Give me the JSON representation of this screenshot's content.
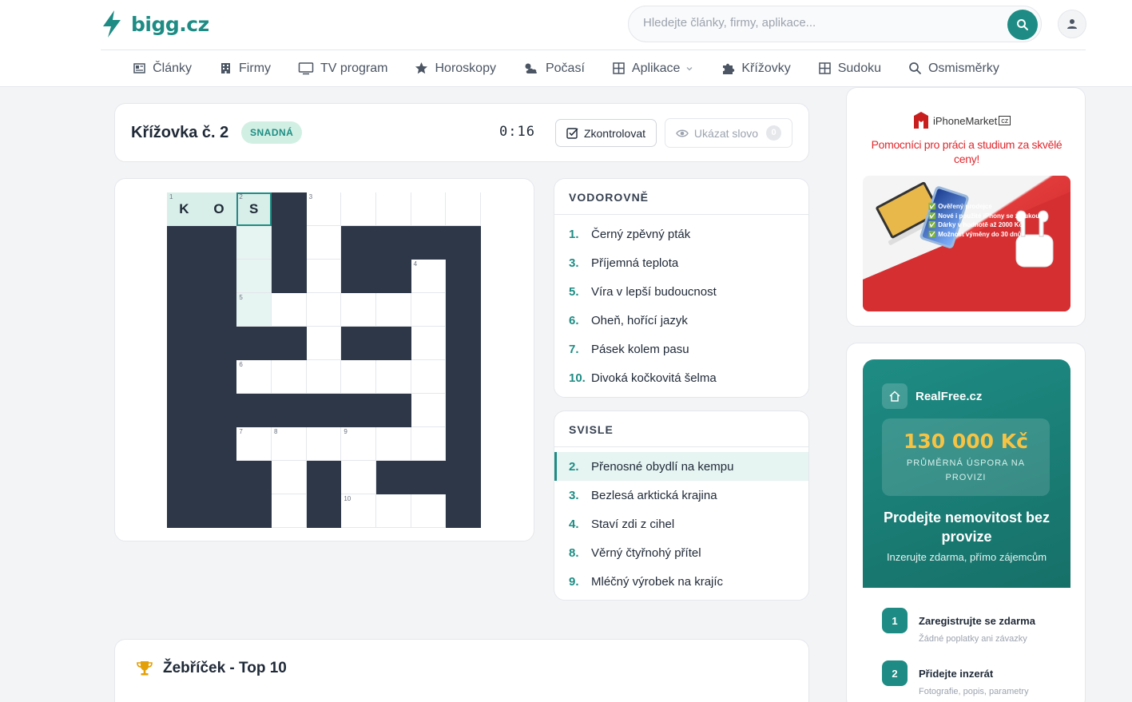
{
  "header": {
    "logo_text": "bigg.cz",
    "search_placeholder": "Hledejte články, firmy, aplikace..."
  },
  "nav": [
    {
      "label": "Články",
      "icon": "newspaper-icon"
    },
    {
      "label": "Firmy",
      "icon": "building-icon"
    },
    {
      "label": "TV program",
      "icon": "tv-icon"
    },
    {
      "label": "Horoskopy",
      "icon": "star-icon"
    },
    {
      "label": "Počasí",
      "icon": "cloud-sun-icon"
    },
    {
      "label": "Aplikace",
      "icon": "grid-icon"
    },
    {
      "label": "Křížovky",
      "icon": "puzzle-icon"
    },
    {
      "label": "Sudoku",
      "icon": "grid-icon"
    },
    {
      "label": "Osmisměrky",
      "icon": "search-icon"
    }
  ],
  "puzzle": {
    "title": "Křížovka č. 2",
    "difficulty": "SNADNÁ",
    "timer": "0:16",
    "check_label": "Zkontrolovat",
    "reveal_label": "Ukázat slovo",
    "reveal_count": "0"
  },
  "grid": {
    "rows": [
      [
        "K",
        "O",
        "S",
        "#",
        "",
        "",
        "",
        "",
        ""
      ],
      [
        "#",
        "#",
        "",
        "#",
        "",
        "#",
        "#",
        "#",
        "#"
      ],
      [
        "#",
        "#",
        "",
        "#",
        "",
        "#",
        "#",
        "",
        "#"
      ],
      [
        "#",
        "#",
        "",
        "",
        "",
        "",
        "",
        "",
        "#"
      ],
      [
        "#",
        "#",
        "#",
        "#",
        "",
        "#",
        "#",
        "",
        "#"
      ],
      [
        "#",
        "#",
        "",
        "",
        "",
        "",
        "",
        "",
        "#"
      ],
      [
        "#",
        "#",
        "#",
        "#",
        "#",
        "#",
        "#",
        "",
        "#"
      ],
      [
        "#",
        "#",
        "",
        "",
        "",
        "",
        "",
        "",
        "#"
      ],
      [
        "#",
        "#",
        "#",
        "",
        "#",
        "",
        "#",
        "#",
        "#"
      ],
      [
        "#",
        "#",
        "#",
        "",
        "#",
        "",
        "",
        "",
        "#"
      ]
    ],
    "numbers": {
      "0-0": "1",
      "0-2": "2",
      "0-4": "3",
      "2-7": "4",
      "3-2": "5",
      "5-2": "6",
      "7-2": "7",
      "7-3": "8",
      "7-5": "9",
      "9-5": "10"
    }
  },
  "clues_across": {
    "heading": "VODOROVNĚ",
    "items": [
      {
        "n": "1.",
        "text": "Černý zpěvný pták"
      },
      {
        "n": "3.",
        "text": "Příjemná teplota"
      },
      {
        "n": "5.",
        "text": "Víra v lepší budoucnost"
      },
      {
        "n": "6.",
        "text": "Oheň, hořící jazyk"
      },
      {
        "n": "7.",
        "text": "Pásek kolem pasu"
      },
      {
        "n": "10.",
        "text": "Divoká kočkovitá šelma"
      }
    ]
  },
  "clues_down": {
    "heading": "SVISLE",
    "items": [
      {
        "n": "2.",
        "text": "Přenosné obydlí na kempu"
      },
      {
        "n": "3.",
        "text": "Bezlesá arktická krajina"
      },
      {
        "n": "4.",
        "text": "Staví zdi z cihel"
      },
      {
        "n": "8.",
        "text": "Věrný čtyřnohý přítel"
      },
      {
        "n": "9.",
        "text": "Mléčný výrobek na krajíc"
      }
    ]
  },
  "leaderboard": {
    "title": "Žebříček - Top 10"
  },
  "ad1": {
    "brand": "iPhoneMarket",
    "brand_suffix": "cz",
    "headline": "Pomocníci pro práci a studium za skvělé ceny!",
    "bullets": [
      "Ověřený prodejce",
      "Nové i použité iPhony se zárukou",
      "Dárky v hodnotě až 2000 Kč",
      "Možnost výměny do 30 dnů"
    ]
  },
  "ad2": {
    "brand": "RealFree.cz",
    "price": "130 000 Kč",
    "price_sub": "PRŮMĚRNÁ ÚSPORA NA PROVIZI",
    "headline": "Prodejte nemovitost bez provize",
    "subline": "Inzerujte zdarma, přímo zájemcům",
    "steps": [
      {
        "n": "1",
        "title": "Zaregistrujte se zdarma",
        "sub": "Žádné poplatky ani závazky"
      },
      {
        "n": "2",
        "title": "Přidejte inzerát",
        "sub": "Fotografie, popis, parametry"
      }
    ]
  },
  "colors": {
    "accent": "#1e8c84",
    "block": "#2d3748",
    "highlight": "#e6f4f2"
  }
}
